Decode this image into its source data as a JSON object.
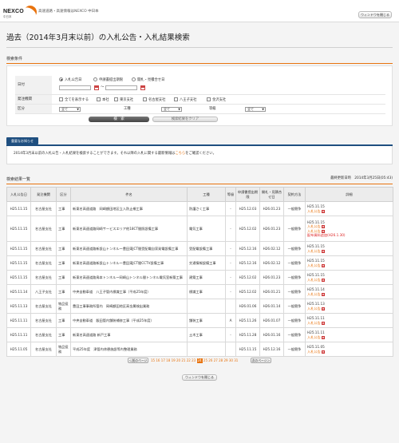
{
  "header": {
    "logo_text": "NEXCO",
    "logo_sub": "中日本",
    "tagline": "高速道路・高速情報はNEXCO 中日本",
    "close_window": "ウィンドウを閉じる"
  },
  "page_title": "過去（2014年3月末以前）の入札公告・入札結果検索",
  "search": {
    "heading": "検索条件",
    "date_label": "日付",
    "date_options": [
      "入札公告日",
      "申請書提出期限",
      "開札・見積合せ日"
    ],
    "date_selected": 0,
    "date_from": "",
    "date_to": "",
    "date_sep": "～",
    "org_label": "発注機関",
    "org_options": [
      "全てを表示する",
      "本社",
      "東京支社",
      "名古屋支社",
      "八王子支社",
      "金沢支社"
    ],
    "class_label": "区分",
    "class_value": "全て",
    "type_label": "工種",
    "type_value": "全て",
    "grade_label": "等級",
    "grade_value": "全て",
    "search_button": "検　索",
    "clear_button": "検索結果をクリア"
  },
  "notice": {
    "tab_label": "重要なお知らせ",
    "text_before": "2014年3月末以前の入札公告・入札結果を検索することができます。それ以降の入札に関する最新情報は",
    "link_text": "こちら",
    "text_after": "をご確認ください。"
  },
  "results": {
    "heading": "検索結果一覧",
    "updated": "最終更新日時　2014年3月25日(05:43)",
    "columns": [
      "入札公告日",
      "発注機関",
      "区分",
      "件名",
      "工種",
      "等級",
      "申請書提出期限",
      "開札・見積合せ日",
      "契約方法",
      "詳細"
    ],
    "rows": [
      {
        "date": "H25.11.15",
        "org": "名古屋支社",
        "cls": "工事",
        "title": "新東名高速道路　岡崎額田地区立入防止柵工事",
        "type": "防護さく工事",
        "grade": "-",
        "deadline": "H25.12.03",
        "open": "H26.01.23",
        "method": "一般競争",
        "details": [
          {
            "text": "H25.11.15",
            "kind": "plain"
          },
          {
            "text": "入札公告",
            "kind": "link"
          }
        ]
      },
      {
        "date": "H25.11.15",
        "org": "名古屋支社",
        "cls": "工事",
        "title": "新東名高速道路岡崎サービスエリア他18CT間照設備工事",
        "type": "電気工事",
        "grade": "-",
        "deadline": "H25.12.02",
        "open": "H26.01.23",
        "method": "一般競争",
        "details": [
          {
            "text": "H25.11.15",
            "kind": "plain"
          },
          {
            "text": "入札公告",
            "kind": "link"
          },
          {
            "text": "入札公告",
            "kind": "link"
          },
          {
            "text": "配布資料追加(H26.1.30)",
            "kind": "red"
          }
        ]
      },
      {
        "date": "H25.11.15",
        "org": "名古屋支社",
        "cls": "工事",
        "title": "新東名高速道路新設山トンネル～豊田東JCT間受配電自家発電設備工事",
        "type": "受配電設備工事",
        "grade": "-",
        "deadline": "H25.12.16",
        "open": "H26.02.12",
        "method": "一般競争",
        "details": [
          {
            "text": "H25.11.15",
            "kind": "plain"
          },
          {
            "text": "入札公告",
            "kind": "link"
          }
        ]
      },
      {
        "date": "H25.11.15",
        "org": "名古屋支社",
        "cls": "工事",
        "title": "新東名高速道路新設山トンネル～豊田東JCT間CCTV設備工事",
        "type": "交通情報設備工事",
        "grade": "-",
        "deadline": "H25.12.16",
        "open": "H26.02.12",
        "method": "一般競争",
        "details": [
          {
            "text": "H25.11.15",
            "kind": "plain"
          },
          {
            "text": "入札公告",
            "kind": "link"
          }
        ]
      },
      {
        "date": "H25.11.15",
        "org": "名古屋支社",
        "cls": "工事",
        "title": "新東名高速道路鳥本トンネル～岡崎山トンネル間トンネル電気室新築工事",
        "type": "建築工事",
        "grade": "-",
        "deadline": "H25.12.02",
        "open": "H26.01.23",
        "method": "一般競争",
        "details": [
          {
            "text": "H25.11.15",
            "kind": "plain"
          },
          {
            "text": "入札公告",
            "kind": "link"
          }
        ]
      },
      {
        "date": "H25.11.14",
        "org": "八王子支社",
        "cls": "工事",
        "title": "中央自動車道　八王子管内標識工事（平成25年度）",
        "type": "標識工事",
        "grade": "-",
        "deadline": "H25.12.02",
        "open": "H26.01.21",
        "method": "一般競争",
        "details": [
          {
            "text": "H25.11.14",
            "kind": "plain"
          },
          {
            "text": "入札公告",
            "kind": "link"
          }
        ]
      },
      {
        "date": "H25.11.13",
        "org": "名古屋支社",
        "cls": "物品役務",
        "title": "豊田工事事務所管内　岡崎額田地区高金属検出業務",
        "type": "",
        "grade": "",
        "deadline": "H26.01.06",
        "open": "H26.01.14",
        "method": "一般競争",
        "details": [
          {
            "text": "H25.11.13",
            "kind": "plain"
          },
          {
            "text": "入札公告",
            "kind": "link"
          }
        ]
      },
      {
        "date": "H25.11.11",
        "org": "名古屋支社",
        "cls": "工事",
        "title": "中央自動車道　飯田管内舗装補修工事（平成25年度）",
        "type": "舗装工事",
        "grade": "A",
        "deadline": "H25.11.26",
        "open": "H26.01.07",
        "method": "一般競争",
        "details": [
          {
            "text": "H25.11.11",
            "kind": "plain"
          },
          {
            "text": "入札公告",
            "kind": "link"
          }
        ]
      },
      {
        "date": "H25.11.11",
        "org": "名古屋支社",
        "cls": "工事",
        "title": "新東名高速道路 新戸工事",
        "type": "土木工事",
        "grade": "-",
        "deadline": "H25.11.28",
        "open": "H26.01.16",
        "method": "一般競争",
        "details": [
          {
            "text": "H25.11.11",
            "kind": "plain"
          },
          {
            "text": "入札公告",
            "kind": "link"
          }
        ]
      },
      {
        "date": "H25.11.05",
        "org": "名古屋支社",
        "cls": "物品役務",
        "title": "平成25年度　津管内休憩施設等内整理業務",
        "type": "",
        "grade": "",
        "deadline": "H25.11.15",
        "open": "H25.12.16",
        "method": "一般競争",
        "details": [
          {
            "text": "H25.11.05",
            "kind": "plain"
          },
          {
            "text": "入札公告",
            "kind": "link"
          }
        ]
      }
    ]
  },
  "pager": {
    "prev": "＜前のページ",
    "next": "次のページ＞",
    "pages": [
      "15",
      "16",
      "17",
      "18",
      "19",
      "20",
      "21",
      "22",
      "23",
      "24",
      "25",
      "26",
      "27",
      "28",
      "29",
      "30",
      "31"
    ],
    "current": "24"
  },
  "footer": {
    "close_window": "ウィンドウを閉じる"
  },
  "colors": {
    "accent": "#e8730e",
    "notice": "#1f4f80",
    "alert": "#d22222"
  }
}
